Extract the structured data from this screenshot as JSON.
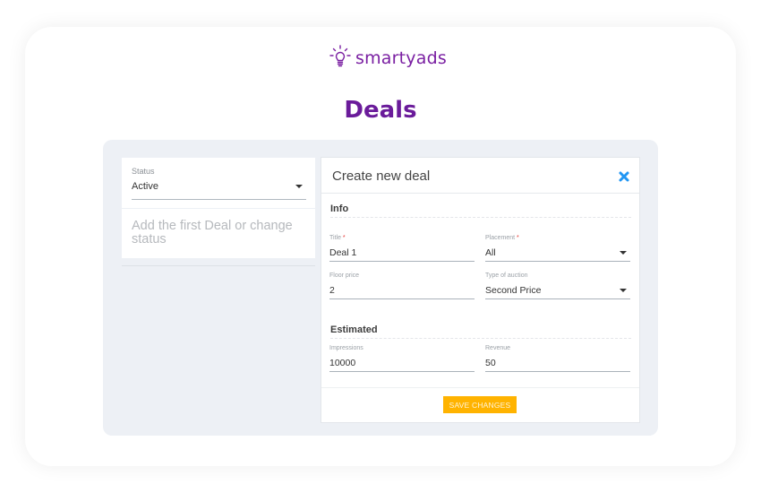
{
  "brand": {
    "name": "smartyads",
    "color": "#7a1fa2",
    "icon": "lightbulb-icon"
  },
  "page": {
    "title": "Deals"
  },
  "filter": {
    "status_label": "Status",
    "status_value": "Active",
    "empty_message": "Add the first Deal or change status"
  },
  "form": {
    "title": "Create new deal",
    "close_icon": "close-icon",
    "close_color": "#2196f3",
    "sections": {
      "info": "Info",
      "estimated": "Estimated"
    },
    "fields": {
      "title": {
        "label": "Title",
        "required_mark": "*",
        "value": "Deal 1"
      },
      "placement": {
        "label": "Placement",
        "required_mark": "*",
        "value": "All"
      },
      "floor_price": {
        "label": "Floor price",
        "value": "2"
      },
      "auction_type": {
        "label": "Type of auction",
        "value": "Second Price"
      },
      "impressions": {
        "label": "Impressions",
        "value": "10000"
      },
      "revenue": {
        "label": "Revenue",
        "value": "50"
      }
    },
    "save_label": "SAVE CHANGES",
    "save_color": "#ffb300"
  }
}
